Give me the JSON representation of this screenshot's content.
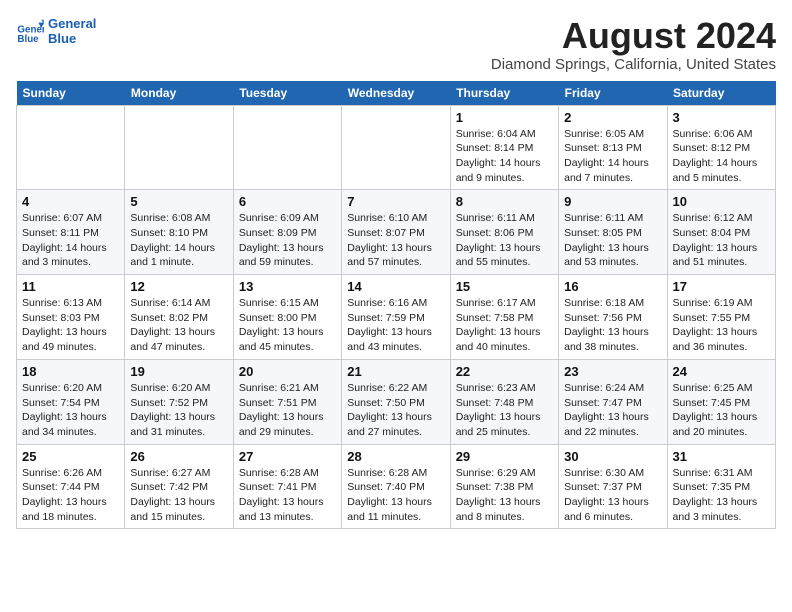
{
  "header": {
    "logo_line1": "General",
    "logo_line2": "Blue",
    "month": "August 2024",
    "location": "Diamond Springs, California, United States"
  },
  "weekdays": [
    "Sunday",
    "Monday",
    "Tuesday",
    "Wednesday",
    "Thursday",
    "Friday",
    "Saturday"
  ],
  "weeks": [
    [
      {
        "day": "",
        "info": ""
      },
      {
        "day": "",
        "info": ""
      },
      {
        "day": "",
        "info": ""
      },
      {
        "day": "",
        "info": ""
      },
      {
        "day": "1",
        "info": "Sunrise: 6:04 AM\nSunset: 8:14 PM\nDaylight: 14 hours\nand 9 minutes."
      },
      {
        "day": "2",
        "info": "Sunrise: 6:05 AM\nSunset: 8:13 PM\nDaylight: 14 hours\nand 7 minutes."
      },
      {
        "day": "3",
        "info": "Sunrise: 6:06 AM\nSunset: 8:12 PM\nDaylight: 14 hours\nand 5 minutes."
      }
    ],
    [
      {
        "day": "4",
        "info": "Sunrise: 6:07 AM\nSunset: 8:11 PM\nDaylight: 14 hours\nand 3 minutes."
      },
      {
        "day": "5",
        "info": "Sunrise: 6:08 AM\nSunset: 8:10 PM\nDaylight: 14 hours\nand 1 minute."
      },
      {
        "day": "6",
        "info": "Sunrise: 6:09 AM\nSunset: 8:09 PM\nDaylight: 13 hours\nand 59 minutes."
      },
      {
        "day": "7",
        "info": "Sunrise: 6:10 AM\nSunset: 8:07 PM\nDaylight: 13 hours\nand 57 minutes."
      },
      {
        "day": "8",
        "info": "Sunrise: 6:11 AM\nSunset: 8:06 PM\nDaylight: 13 hours\nand 55 minutes."
      },
      {
        "day": "9",
        "info": "Sunrise: 6:11 AM\nSunset: 8:05 PM\nDaylight: 13 hours\nand 53 minutes."
      },
      {
        "day": "10",
        "info": "Sunrise: 6:12 AM\nSunset: 8:04 PM\nDaylight: 13 hours\nand 51 minutes."
      }
    ],
    [
      {
        "day": "11",
        "info": "Sunrise: 6:13 AM\nSunset: 8:03 PM\nDaylight: 13 hours\nand 49 minutes."
      },
      {
        "day": "12",
        "info": "Sunrise: 6:14 AM\nSunset: 8:02 PM\nDaylight: 13 hours\nand 47 minutes."
      },
      {
        "day": "13",
        "info": "Sunrise: 6:15 AM\nSunset: 8:00 PM\nDaylight: 13 hours\nand 45 minutes."
      },
      {
        "day": "14",
        "info": "Sunrise: 6:16 AM\nSunset: 7:59 PM\nDaylight: 13 hours\nand 43 minutes."
      },
      {
        "day": "15",
        "info": "Sunrise: 6:17 AM\nSunset: 7:58 PM\nDaylight: 13 hours\nand 40 minutes."
      },
      {
        "day": "16",
        "info": "Sunrise: 6:18 AM\nSunset: 7:56 PM\nDaylight: 13 hours\nand 38 minutes."
      },
      {
        "day": "17",
        "info": "Sunrise: 6:19 AM\nSunset: 7:55 PM\nDaylight: 13 hours\nand 36 minutes."
      }
    ],
    [
      {
        "day": "18",
        "info": "Sunrise: 6:20 AM\nSunset: 7:54 PM\nDaylight: 13 hours\nand 34 minutes."
      },
      {
        "day": "19",
        "info": "Sunrise: 6:20 AM\nSunset: 7:52 PM\nDaylight: 13 hours\nand 31 minutes."
      },
      {
        "day": "20",
        "info": "Sunrise: 6:21 AM\nSunset: 7:51 PM\nDaylight: 13 hours\nand 29 minutes."
      },
      {
        "day": "21",
        "info": "Sunrise: 6:22 AM\nSunset: 7:50 PM\nDaylight: 13 hours\nand 27 minutes."
      },
      {
        "day": "22",
        "info": "Sunrise: 6:23 AM\nSunset: 7:48 PM\nDaylight: 13 hours\nand 25 minutes."
      },
      {
        "day": "23",
        "info": "Sunrise: 6:24 AM\nSunset: 7:47 PM\nDaylight: 13 hours\nand 22 minutes."
      },
      {
        "day": "24",
        "info": "Sunrise: 6:25 AM\nSunset: 7:45 PM\nDaylight: 13 hours\nand 20 minutes."
      }
    ],
    [
      {
        "day": "25",
        "info": "Sunrise: 6:26 AM\nSunset: 7:44 PM\nDaylight: 13 hours\nand 18 minutes."
      },
      {
        "day": "26",
        "info": "Sunrise: 6:27 AM\nSunset: 7:42 PM\nDaylight: 13 hours\nand 15 minutes."
      },
      {
        "day": "27",
        "info": "Sunrise: 6:28 AM\nSunset: 7:41 PM\nDaylight: 13 hours\nand 13 minutes."
      },
      {
        "day": "28",
        "info": "Sunrise: 6:28 AM\nSunset: 7:40 PM\nDaylight: 13 hours\nand 11 minutes."
      },
      {
        "day": "29",
        "info": "Sunrise: 6:29 AM\nSunset: 7:38 PM\nDaylight: 13 hours\nand 8 minutes."
      },
      {
        "day": "30",
        "info": "Sunrise: 6:30 AM\nSunset: 7:37 PM\nDaylight: 13 hours\nand 6 minutes."
      },
      {
        "day": "31",
        "info": "Sunrise: 6:31 AM\nSunset: 7:35 PM\nDaylight: 13 hours\nand 3 minutes."
      }
    ]
  ]
}
